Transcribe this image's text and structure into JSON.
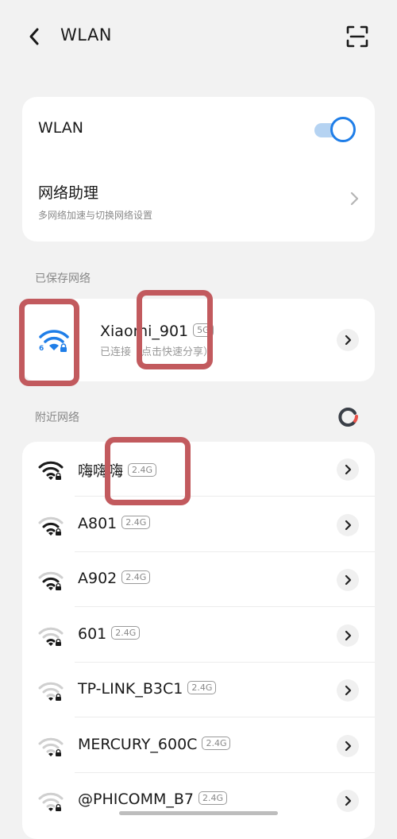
{
  "header": {
    "title": "WLAN"
  },
  "wlan": {
    "label": "WLAN",
    "enabled": true
  },
  "assistant": {
    "label": "网络助理",
    "sublabel": "多网络加速与切换网络设置"
  },
  "saved": {
    "section_label": "已保存网络",
    "network": {
      "name": "Xiaomi_901",
      "band": "5G",
      "wifi_gen": "6",
      "status": "已连接（点击快速分享）"
    }
  },
  "nearby": {
    "section_label": "附近网络",
    "networks": [
      {
        "name": "嗨嗨嗨",
        "band": "2.4G",
        "signal": 4
      },
      {
        "name": "A801",
        "band": "2.4G",
        "signal": 3
      },
      {
        "name": "A902",
        "band": "2.4G",
        "signal": 3
      },
      {
        "name": "601",
        "band": "2.4G",
        "signal": 2
      },
      {
        "name": "TP-LINK_B3C1",
        "band": "2.4G",
        "signal": 1
      },
      {
        "name": "MERCURY_600C",
        "band": "2.4G",
        "signal": 1
      },
      {
        "name": "@PHICOMM_B7",
        "band": "2.4G",
        "signal": 1
      }
    ]
  },
  "colors": {
    "accent": "#1f7ee8",
    "highlight": "#c25a5e"
  }
}
